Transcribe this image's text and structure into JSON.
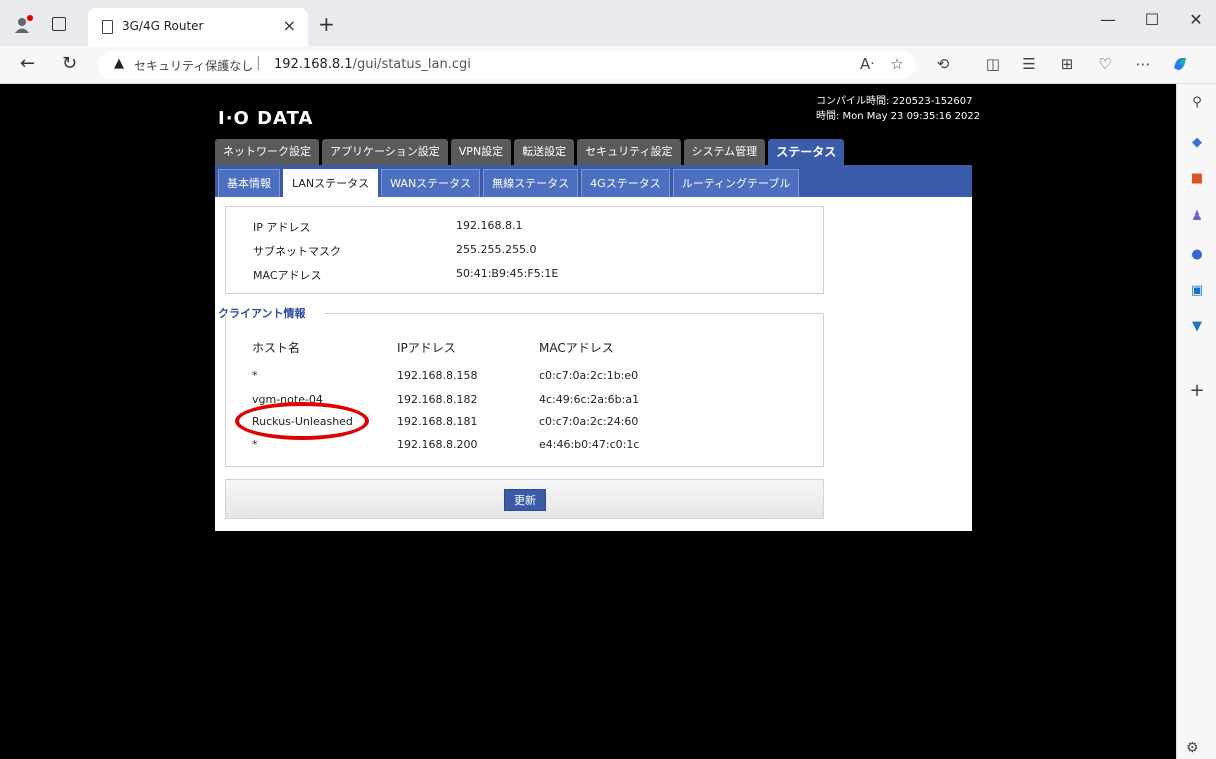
{
  "browser": {
    "tab_title": "3G/4G Router",
    "security_text": "セキュリティ保護なし",
    "url_host": "192.168.8.1",
    "url_path": "/gui/status_lan.cgi"
  },
  "icons": {
    "profile": "profile-icon",
    "tabs": "tab-actions-icon",
    "page": "page-icon",
    "close": "close-icon",
    "new_tab": "plus-icon",
    "minimize": "minimize-icon",
    "maximize": "maximize-icon",
    "window_close": "close-icon",
    "back": "back-icon",
    "refresh": "refresh-icon",
    "warning": "warning-icon",
    "read_aloud": "read-aloud-icon",
    "favorite": "star-icon",
    "extensions": "extensions-icon",
    "split": "split-screen-icon",
    "favorites": "favorites-list-icon",
    "collections": "collections-icon",
    "browser_essentials": "heart-pulse-icon",
    "more": "more-icon",
    "copilot": "copilot-icon",
    "settings": "gear-icon"
  },
  "colors": {
    "accent": "#3a5ba8",
    "tab_inactive": "#5a5a5a",
    "section_label": "#2e4a99",
    "highlight": "#e00000"
  },
  "header": {
    "logo": "I·O DATA",
    "compile_time": "コンパイル時間: 220523-152607",
    "current_time": "時間: Mon May 23 09:35:16 2022"
  },
  "main_tabs": [
    {
      "label": "ネットワーク設定"
    },
    {
      "label": "アプリケーション設定"
    },
    {
      "label": "VPN設定"
    },
    {
      "label": "転送設定"
    },
    {
      "label": "セキュリティ設定"
    },
    {
      "label": "システム管理"
    },
    {
      "label": "ステータス"
    }
  ],
  "sub_tabs": [
    {
      "label": "基本情報"
    },
    {
      "label": "LANステータス"
    },
    {
      "label": "WANステータス"
    },
    {
      "label": "無線ステータス"
    },
    {
      "label": "4Gステータス"
    },
    {
      "label": "ルーティングテーブル"
    }
  ],
  "lan_info": [
    {
      "label": "IP アドレス",
      "value": "192.168.8.1"
    },
    {
      "label": "サブネットマスク",
      "value": "255.255.255.0"
    },
    {
      "label": "MACアドレス",
      "value": "50:41:B9:45:F5:1E"
    }
  ],
  "clients": {
    "section_title": "クライアント情報",
    "headers": {
      "host": "ホスト名",
      "ip": "IPアドレス",
      "mac": "MACアドレス"
    },
    "rows": [
      {
        "host": "*",
        "ip": "192.168.8.158",
        "mac": "c0:c7:0a:2c:1b:e0"
      },
      {
        "host": "vgm-note-04",
        "ip": "192.168.8.182",
        "mac": "4c:49:6c:2a:6b:a1"
      },
      {
        "host": "Ruckus-Unleashed",
        "ip": "192.168.8.181",
        "mac": "c0:c7:0a:2c:24:60"
      },
      {
        "host": "*",
        "ip": "192.168.8.200",
        "mac": "e4:46:b0:47:c0:1c"
      }
    ]
  },
  "refresh_button": "更新"
}
